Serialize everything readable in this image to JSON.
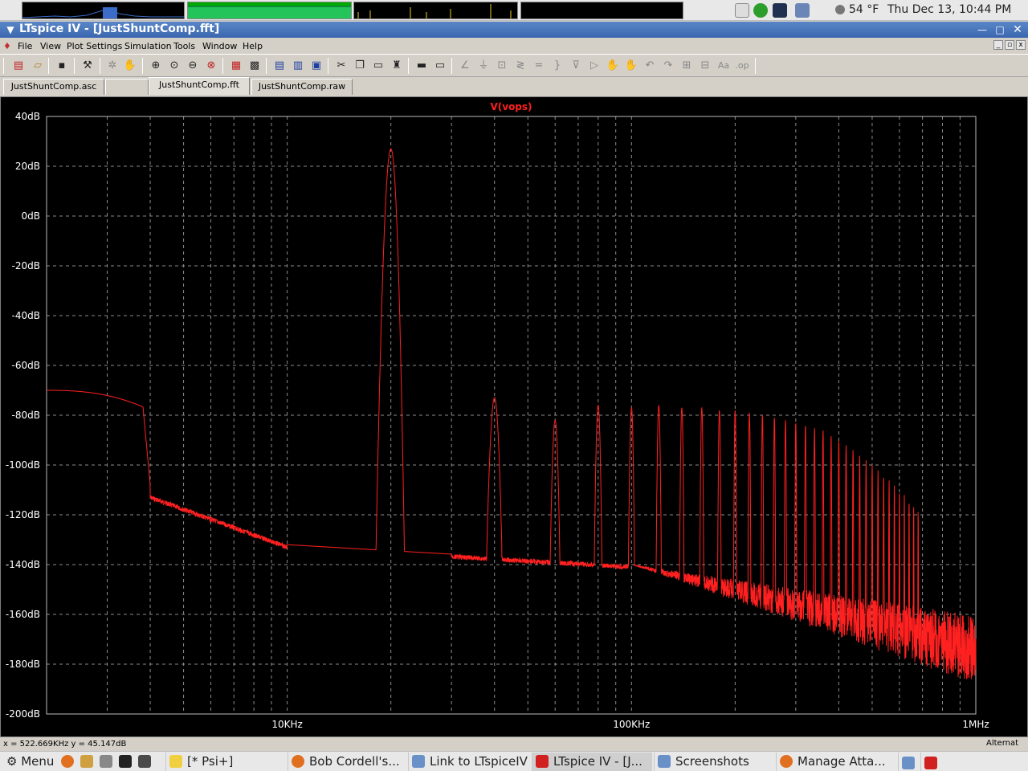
{
  "top_panel": {
    "weather": "54 °F",
    "clock": "Thu Dec 13, 10:44 PM"
  },
  "window": {
    "title": "LTspice IV - [JustShuntComp.fft]"
  },
  "menu": {
    "items": [
      "File",
      "View",
      "Plot Settings",
      "Simulation",
      "Tools",
      "Window",
      "Help"
    ]
  },
  "toolbar": {
    "icons": [
      "new-schematic-icon",
      "open-icon",
      "save-icon",
      "control-panel-icon",
      "run-icon",
      "halt-icon",
      "zoom-area-icon",
      "zoom-back-icon",
      "zoom-fit-icon",
      "autorange-icon",
      "tile-icon",
      "cascade-icon",
      "close-icon",
      "cut-icon",
      "copy-icon",
      "paste-icon",
      "find-icon",
      "print-icon",
      "print-setup-icon"
    ]
  },
  "tabs": [
    {
      "label": "JustShuntComp.asc"
    },
    {
      "label": ""
    },
    {
      "label": "JustShuntComp.fft"
    },
    {
      "label": "JustShuntComp.raw"
    }
  ],
  "colors": {
    "trace": "#ff2020",
    "grid": "#8c8c8c",
    "axis_text": "#ffffff",
    "background": "#000000"
  },
  "chart_data": {
    "type": "line",
    "title": "V(vops)",
    "xscale": "log",
    "xlim": [
      2000,
      1000000
    ],
    "ylim": [
      -200,
      40
    ],
    "ylabel_unit": "dB",
    "x_tick_labels": [
      {
        "value": 10000,
        "label": "10KHz"
      },
      {
        "value": 100000,
        "label": "100KHz"
      },
      {
        "value": 1000000,
        "label": "1MHz"
      }
    ],
    "y_tick_labels": [
      "40dB",
      "20dB",
      "0dB",
      "-20dB",
      "-40dB",
      "-60dB",
      "-80dB",
      "-100dB",
      "-120dB",
      "-140dB",
      "-160dB",
      "-180dB",
      "-200dB"
    ],
    "y_tick_values": [
      40,
      20,
      0,
      -20,
      -40,
      -60,
      -80,
      -100,
      -120,
      -140,
      -160,
      -180,
      -200
    ],
    "fundamental": {
      "freq": 20000,
      "peak_db": 27
    },
    "low_freq_start_db": -70,
    "harmonic_peaks_db": [
      -73,
      -82,
      -76,
      -77,
      -76,
      -77,
      -77,
      -78,
      -78,
      -79,
      -80,
      -81,
      -82,
      -83,
      -84,
      -85,
      -86,
      -88,
      -90,
      -92,
      -94,
      -96,
      -98,
      -100,
      -102,
      -104,
      -106,
      -108,
      -110,
      -112,
      -114,
      -116,
      -118
    ],
    "noise_floor_db": {
      "at_10k": -132,
      "at_100k": -140,
      "at_1M": -160
    }
  },
  "status": {
    "coords": "x = 522.669KHz    y = 45.147dB",
    "right": "Alternat"
  },
  "taskbar": {
    "menu_label": "Menu",
    "tasks": [
      "[* Psi+]",
      "Bob Cordell's...",
      "Link to LTspiceIV",
      "LTspice IV - [J...",
      "Screenshots",
      "Manage Atta..."
    ]
  }
}
